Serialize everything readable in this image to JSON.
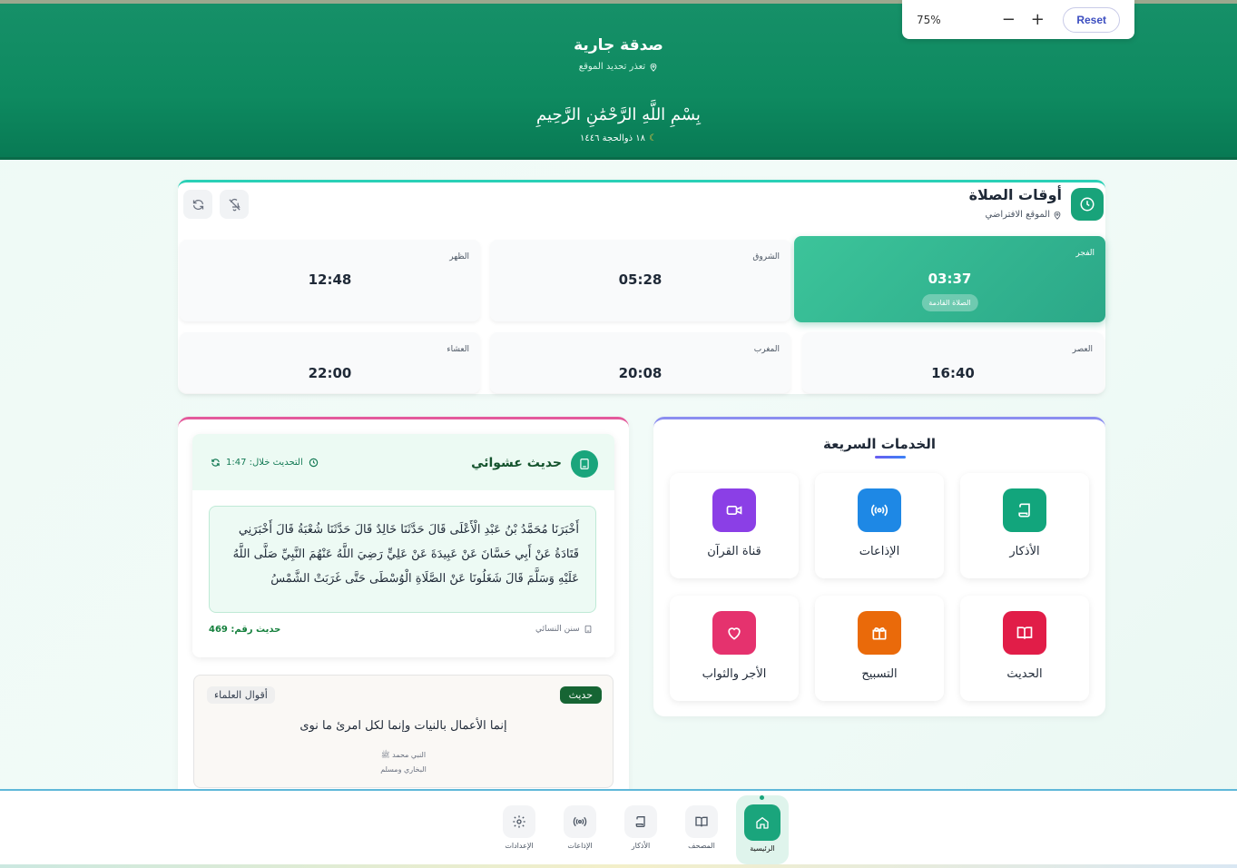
{
  "zoom": {
    "level": "75%",
    "minus": "−",
    "plus": "+",
    "reset_label": "Reset"
  },
  "header": {
    "title": "صدقة جارية",
    "location_status": "تعذر تحديد الموقع",
    "basmala": "بِسْمِ اللَّهِ الرَّحْمَٰنِ الرَّحِيمِ",
    "hijri_date": "١٨ ذوالحجة ١٤٤٦"
  },
  "prayer": {
    "title": "أوقات الصلاة",
    "location": "الموقع الافتراضي",
    "next_label": "الصلاة القادمة",
    "times": [
      {
        "name": "الفجر",
        "time": "03:37"
      },
      {
        "name": "الشروق",
        "time": "05:28"
      },
      {
        "name": "الظهر",
        "time": "12:48"
      },
      {
        "name": "العصر",
        "time": "16:40"
      },
      {
        "name": "المغرب",
        "time": "20:08"
      },
      {
        "name": "العشاء",
        "time": "22:00"
      }
    ]
  },
  "hadith": {
    "title": "حديث عشوائي",
    "refresh_label": "التحديث خلال: 1:47",
    "text": "أَخْبَرَنَا مُحَمَّدُ بْنُ عَبْدِ الْأَعْلَى قَالَ حَدَّثَنَا خَالِدٌ قَالَ حَدَّثَنَا شُعْبَةُ قَالَ أَخْبَرَنِي قَتَادَةُ عَنْ أَبِي حَسَّانَ عَنْ عَبِيدَةَ عَنْ عَلِيٍّ رَضِيَ اللَّهُ عَنْهُمَ النَّبِيِّ صَلَّى اللَّهُ عَلَيْهِ وَسَلَّمَ قَالَ شَغَلُونَا عَنْ الصَّلَاةِ الْوُسْطَى حَتَّى غَرَبَتْ الشَّمْسُ",
    "source": "سنن النسائي",
    "number_label": "حديث رقم: 469"
  },
  "quote": {
    "badge": "حديث",
    "tag": "أقوال العلماء",
    "text": "إنما الأعمال بالنيات وإنما لكل امرئ ما نوى",
    "author": "النبي محمد ﷺ",
    "source": "البخاري ومسلم"
  },
  "services": {
    "title": "الخدمات السريعة",
    "items": [
      {
        "label": "الأذكار",
        "color": "#12a57c"
      },
      {
        "label": "الإذاعات",
        "color": "#1e88e5"
      },
      {
        "label": "قناة القرآن",
        "color": "#8b3fe6"
      },
      {
        "label": "الحديث",
        "color": "#e11d48"
      },
      {
        "label": "التسبيح",
        "color": "#ea6a0a"
      },
      {
        "label": "الأجر والثواب",
        "color": "#e5326e"
      }
    ]
  },
  "nav": {
    "items": [
      {
        "label": "الإعدادات"
      },
      {
        "label": "الإذاعات"
      },
      {
        "label": "الأذكار"
      },
      {
        "label": "المصحف"
      },
      {
        "label": "الرئيسية"
      }
    ]
  }
}
